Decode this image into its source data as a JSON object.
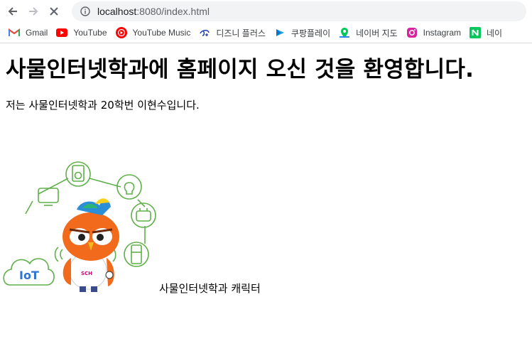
{
  "browser": {
    "url_host": "localhost",
    "url_path": ":8080/index.html"
  },
  "bookmarks": [
    {
      "label": "Gmail",
      "icon": "gmail-icon"
    },
    {
      "label": "YouTube",
      "icon": "youtube-icon"
    },
    {
      "label": "YouTube Music",
      "icon": "youtube-music-icon"
    },
    {
      "label": "디즈니 플러스",
      "icon": "disney-plus-icon"
    },
    {
      "label": "쿠팡플레이",
      "icon": "coupang-play-icon"
    },
    {
      "label": "네이버 지도",
      "icon": "naver-map-icon"
    },
    {
      "label": "Instagram",
      "icon": "instagram-icon"
    },
    {
      "label": "네이",
      "icon": "naver-icon"
    }
  ],
  "page": {
    "heading": "사물인터넷학과에 홈페이지 오신 것을 환영합니다.",
    "intro": "저는 사물인터넷학과 20학번 이현수입니다.",
    "image_caption": "사물인터넷학과 캐릭터",
    "mascot_badge": "IoT",
    "mascot_shirt": "SCH"
  }
}
